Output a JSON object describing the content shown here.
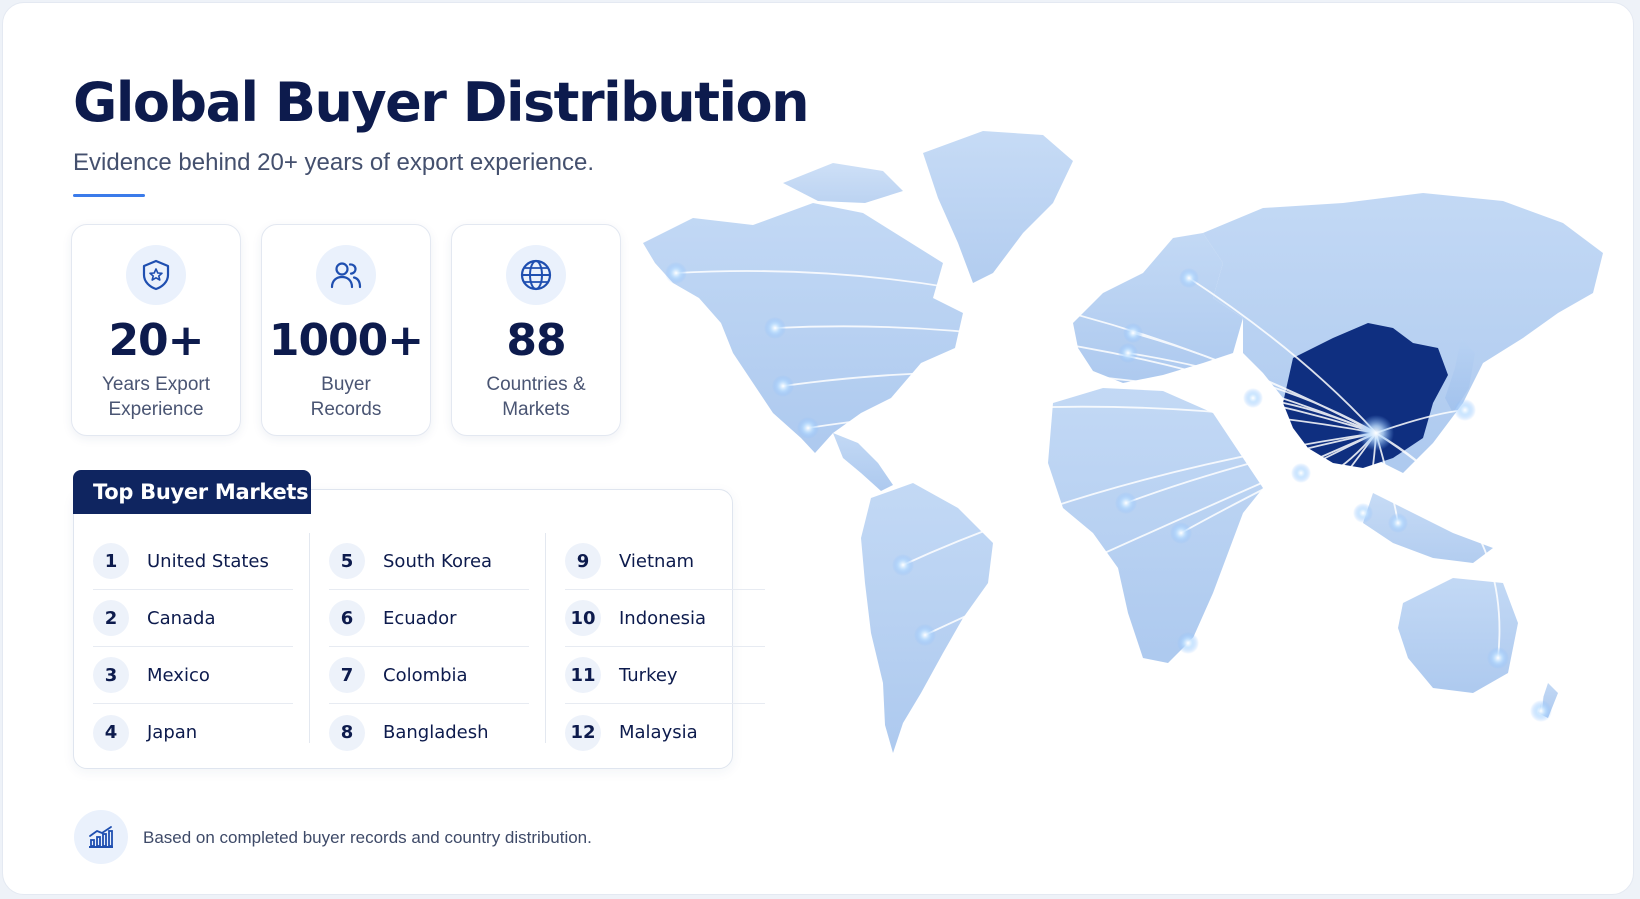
{
  "title": "Global Buyer Distribution",
  "subtitle": "Evidence behind 20+ years of export experience.",
  "colors": {
    "navy": "#0d1b4d",
    "accent": "#3b7bea",
    "map": "#a9c7ef",
    "china": "#0f2f80"
  },
  "stats": [
    {
      "icon": "shield-star-icon",
      "value": "20+",
      "label_line1": "Years Export",
      "label_line2": "Experience"
    },
    {
      "icon": "users-icon",
      "value": "1000+",
      "label_line1": "Buyer",
      "label_line2": "Records"
    },
    {
      "icon": "globe-icon",
      "value": "88",
      "label_line1": "Countries &",
      "label_line2": "Markets"
    }
  ],
  "markets": {
    "heading": "Top Buyer Markets",
    "columns": [
      [
        {
          "rank": "1",
          "name": "United States"
        },
        {
          "rank": "2",
          "name": "Canada"
        },
        {
          "rank": "3",
          "name": "Mexico"
        },
        {
          "rank": "4",
          "name": "Japan"
        }
      ],
      [
        {
          "rank": "5",
          "name": "South Korea"
        },
        {
          "rank": "6",
          "name": "Ecuador"
        },
        {
          "rank": "7",
          "name": "Colombia"
        },
        {
          "rank": "8",
          "name": "Bangladesh"
        }
      ],
      [
        {
          "rank": "9",
          "name": "Vietnam"
        },
        {
          "rank": "10",
          "name": "Indonesia"
        },
        {
          "rank": "11",
          "name": "Turkey"
        },
        {
          "rank": "12",
          "name": "Malaysia"
        }
      ]
    ]
  },
  "note": {
    "icon": "chart-growth-icon",
    "text": "Based on completed buyer records and country distribution."
  }
}
